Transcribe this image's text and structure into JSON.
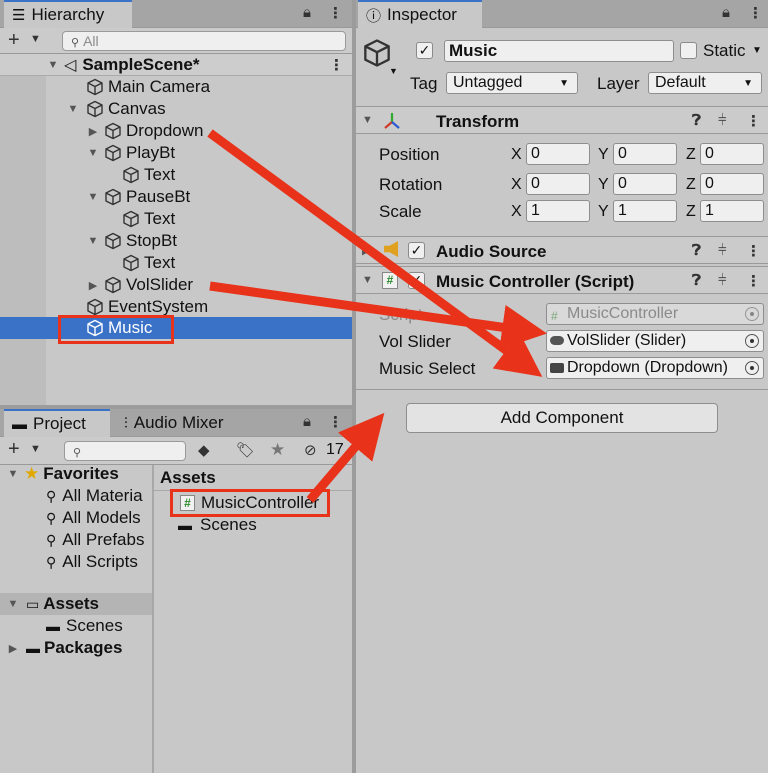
{
  "hierarchy": {
    "tab_label": "Hierarchy",
    "search_placeholder": "All",
    "scene_name": "SampleScene*",
    "items": [
      "Main Camera",
      "Canvas",
      "Dropdown",
      "PlayBt",
      "Text",
      "PauseBt",
      "Text",
      "StopBt",
      "Text",
      "VolSlider",
      "EventSystem",
      "Music"
    ]
  },
  "inspector": {
    "tab_label": "Inspector",
    "object_name": "Music",
    "static_label": "Static",
    "tag_label": "Tag",
    "tag_value": "Untagged",
    "layer_label": "Layer",
    "layer_value": "Default",
    "transform": {
      "title": "Transform",
      "rows": [
        {
          "label": "Position",
          "x": "0",
          "y": "0",
          "z": "0"
        },
        {
          "label": "Rotation",
          "x": "0",
          "y": "0",
          "z": "0"
        },
        {
          "label": "Scale",
          "x": "1",
          "y": "1",
          "z": "1"
        }
      ],
      "axes": [
        "X",
        "Y",
        "Z"
      ]
    },
    "audio_source_title": "Audio Source",
    "music_controller": {
      "title": "Music Controller (Script)",
      "script_label": "Script",
      "script_value": "MusicController",
      "vol_slider_label": "Vol Slider",
      "vol_slider_value": "VolSlider (Slider)",
      "music_select_label": "Music Select",
      "music_select_value": "Dropdown (Dropdown)"
    },
    "add_component": "Add Component"
  },
  "project": {
    "tab_label": "Project",
    "audio_mixer_tab": "Audio Mixer",
    "hidden_count": "17",
    "favorites_label": "Favorites",
    "favorites": [
      "All Materia",
      "All Models",
      "All Prefabs",
      "All Scripts"
    ],
    "assets_label": "Assets",
    "assets_children": [
      "Scenes"
    ],
    "packages_label": "Packages",
    "assets_header": "Assets",
    "asset_items": [
      "MusicController",
      "Scenes"
    ]
  },
  "colors": {
    "selection": "#3a72c8",
    "annotation": "#e8321a",
    "panel_bg": "#c8c8c8"
  }
}
